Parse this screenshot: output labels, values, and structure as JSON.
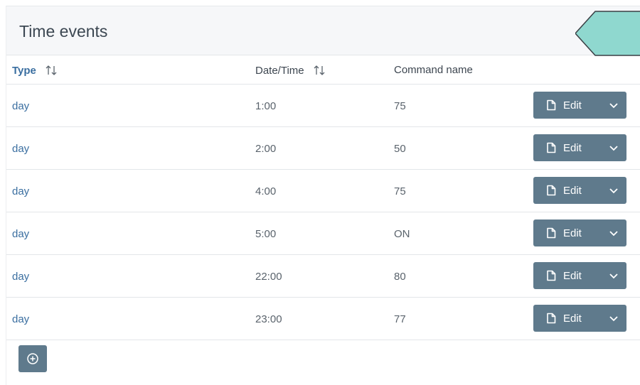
{
  "header": {
    "title": "Time events"
  },
  "table": {
    "columns": {
      "type": "Type",
      "datetime": "Date/Time",
      "command": "Command name"
    },
    "rows": [
      {
        "type": "day",
        "time": "1:00",
        "command": "75",
        "action": "Edit"
      },
      {
        "type": "day",
        "time": "2:00",
        "command": "50",
        "action": "Edit"
      },
      {
        "type": "day",
        "time": "4:00",
        "command": "75",
        "action": "Edit"
      },
      {
        "type": "day",
        "time": "5:00",
        "command": "ON",
        "action": "Edit"
      },
      {
        "type": "day",
        "time": "22:00",
        "command": "80",
        "action": "Edit"
      },
      {
        "type": "day",
        "time": "23:00",
        "command": "77",
        "action": "Edit"
      }
    ]
  },
  "icons": {
    "sort": "sort-updown-icon",
    "edit": "document-icon",
    "dropdown": "chevron-down-icon",
    "add": "plus-circle-icon"
  },
  "colors": {
    "accent_link": "#3a6ea0",
    "button_bg": "#5f7a8c",
    "badge_fill": "#8fd8cf",
    "header_bg": "#f6f7f9"
  }
}
